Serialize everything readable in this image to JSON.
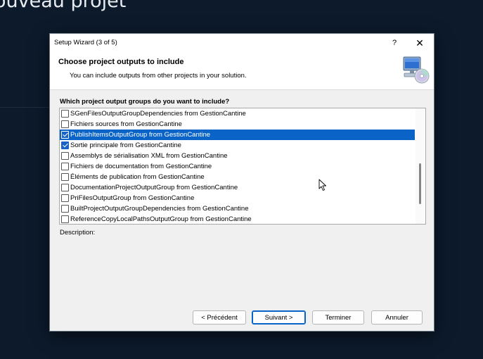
{
  "background": {
    "title": "ouveau projet"
  },
  "dialog": {
    "title": "Setup Wizard (3 of 5)",
    "help_label": "?",
    "close_label": "✕",
    "heading": "Choose project outputs to include",
    "subheading": "You can include outputs from other projects in your solution.",
    "question": "Which project output groups do you want to include?",
    "items": [
      {
        "label": "SGenFilesOutputGroupDependencies from GestionCantine",
        "checked": false,
        "selected": false
      },
      {
        "label": "Fichiers sources from GestionCantine",
        "checked": false,
        "selected": false
      },
      {
        "label": "PublishItemsOutputGroup from GestionCantine",
        "checked": true,
        "selected": true
      },
      {
        "label": "Sortie principale from GestionCantine",
        "checked": true,
        "selected": false
      },
      {
        "label": "Assemblys de sérialisation XML from GestionCantine",
        "checked": false,
        "selected": false
      },
      {
        "label": "Fichiers de documentation from GestionCantine",
        "checked": false,
        "selected": false
      },
      {
        "label": "Éléments de publication from GestionCantine",
        "checked": false,
        "selected": false
      },
      {
        "label": "DocumentationProjectOutputGroup from GestionCantine",
        "checked": false,
        "selected": false
      },
      {
        "label": "PriFilesOutputGroup from GestionCantine",
        "checked": false,
        "selected": false
      },
      {
        "label": "BuiltProjectOutputGroupDependencies from GestionCantine",
        "checked": false,
        "selected": false
      },
      {
        "label": "ReferenceCopyLocalPathsOutputGroup from GestionCantine",
        "checked": false,
        "selected": false
      }
    ],
    "description_label": "Description:",
    "buttons": {
      "previous": "< Précédent",
      "next": "Suivant >",
      "finish": "Terminer",
      "cancel": "Annuler"
    }
  },
  "colors": {
    "selection": "#0a64c8",
    "checkbox_checked": "#1a63c6"
  }
}
